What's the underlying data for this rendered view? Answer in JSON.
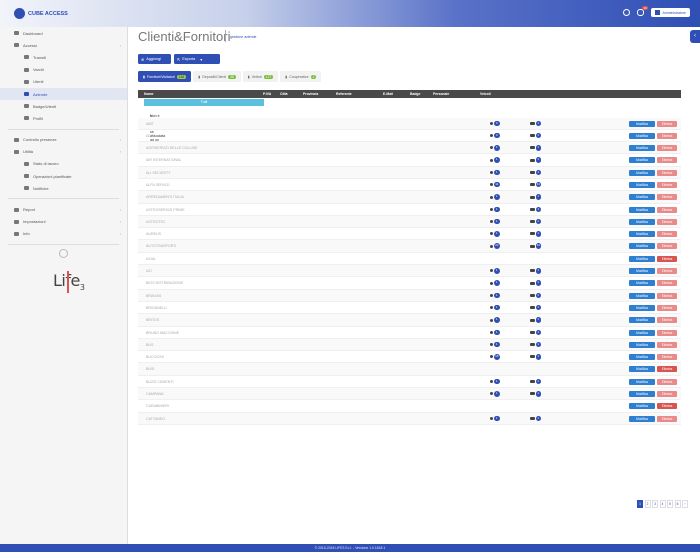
{
  "app": {
    "logo_text": "CUBE ACCESS"
  },
  "topbar": {
    "notif_count": "10",
    "user_label": "Amministratore"
  },
  "sidebar": {
    "items": [
      {
        "label": "Dashboard",
        "sub": false,
        "chev": false,
        "active": false
      },
      {
        "label": "Accessi",
        "sub": false,
        "chev": true,
        "active": false
      },
      {
        "label": "Transiti",
        "sub": true,
        "chev": false,
        "active": false
      },
      {
        "label": "Varchi",
        "sub": true,
        "chev": false,
        "active": false
      },
      {
        "label": "Utenti",
        "sub": true,
        "chev": false,
        "active": false
      },
      {
        "label": "Aziende",
        "sub": true,
        "chev": false,
        "active": true
      },
      {
        "label": "Badge/Utenti",
        "sub": true,
        "chev": false,
        "active": false
      },
      {
        "label": "Profili",
        "sub": true,
        "chev": false,
        "active": false
      },
      {
        "label": "Controllo presenze",
        "sub": false,
        "chev": true,
        "active": false
      },
      {
        "label": "Utilità",
        "sub": false,
        "chev": true,
        "active": false
      },
      {
        "label": "Stato di lavoro",
        "sub": true,
        "chev": false,
        "active": false
      },
      {
        "label": "Operazioni pianificate",
        "sub": true,
        "chev": false,
        "active": false
      },
      {
        "label": "Notifiche",
        "sub": true,
        "chev": false,
        "active": false
      },
      {
        "label": "Report",
        "sub": false,
        "chev": true,
        "active": false
      },
      {
        "label": "Impostazioni",
        "sub": false,
        "chev": true,
        "active": false
      },
      {
        "label": "Info",
        "sub": false,
        "chev": true,
        "active": false
      }
    ],
    "brand_text": "Life",
    "brand_sub": "3"
  },
  "header": {
    "title": "Clienti&Fornitori",
    "subtitle": "gestione aziende"
  },
  "toolbar": {
    "add_label": "Aggiungi",
    "export_label": "Esporta"
  },
  "tabs": [
    {
      "label": "Fornitori/Visitatori",
      "count": "146",
      "active": true
    },
    {
      "label": "Depositi/Clienti",
      "count": "38",
      "active": false
    },
    {
      "label": "Vettori",
      "count": "127",
      "active": false
    },
    {
      "label": "Cooperative",
      "count": "2",
      "active": false
    }
  ],
  "table": {
    "columns": [
      "Nome",
      "P.IVA",
      "Città",
      "Provincia",
      "Referente",
      "E-Mail",
      "Badge",
      "Personale",
      "Veicoli"
    ],
    "filter_label": "Tutti",
    "note": "Non è possibile eliminare un'azienda se associata ad un utente o mezzo",
    "edit_label": "Modifica",
    "delete_label": "Elimina",
    "rows": [
      {
        "name": "ABIT",
        "pers": "3",
        "veic": "1"
      },
      {
        "name": "ADIT",
        "pers": "3",
        "veic": "1"
      },
      {
        "name": "AGRISERVIZI DELLE COLLINE",
        "pers": "1",
        "veic": "1"
      },
      {
        "name": "AIR INTERNATIONAL",
        "pers": "1",
        "veic": "1"
      },
      {
        "name": "ALI SECURITY",
        "pers": "1",
        "veic": "1"
      },
      {
        "name": "ALFA SERVIZI",
        "pers": "11",
        "veic": "13"
      },
      {
        "name": "ARREDAMENTI ITALIA",
        "pers": "1",
        "veic": "1"
      },
      {
        "name": "ASTROSERVIZI PRIME",
        "pers": "1",
        "veic": "1"
      },
      {
        "name": "ASTROTEC",
        "pers": "1",
        "veic": "1"
      },
      {
        "name": "AUREUS",
        "pers": "1",
        "veic": "1"
      },
      {
        "name": "AUTOTRASPORTI",
        "pers": "24",
        "veic": "13"
      },
      {
        "name": "AXIAL",
        "pers": "",
        "veic": "",
        "strong": true
      },
      {
        "name": "AZI",
        "pers": "1",
        "veic": "1"
      },
      {
        "name": "BIOS DISTRIBUZIONE",
        "pers": "1",
        "veic": "1"
      },
      {
        "name": "BRAVIAS",
        "pers": "1",
        "veic": "1"
      },
      {
        "name": "BRIGANELLI",
        "pers": "1",
        "veic": "1"
      },
      {
        "name": "BRITOS",
        "pers": "1",
        "veic": "1"
      },
      {
        "name": "BRUNO MACCHINE",
        "pers": "1",
        "veic": "1"
      },
      {
        "name": "BUS",
        "pers": "1",
        "veic": "1"
      },
      {
        "name": "BUCCIONI",
        "pers": "18",
        "veic": "1"
      },
      {
        "name": "BUSI",
        "pers": "",
        "veic": "",
        "strong": true
      },
      {
        "name": "BUZZI CEMENTI",
        "pers": "1",
        "veic": "1"
      },
      {
        "name": "CAMPANA",
        "pers": "1",
        "veic": "1"
      },
      {
        "name": "CARABINIERI",
        "pers": "",
        "veic": "",
        "strong": true
      },
      {
        "name": "CATTANEO",
        "pers": "1",
        "veic": "1"
      }
    ]
  },
  "pagination": {
    "pages": [
      "1",
      "2",
      "3",
      "4",
      "5",
      "6",
      "›"
    ],
    "active": "1"
  },
  "footer": {
    "text": "© 2015-2018 LIFE3 S.r.l. - Versione 1.0.1618.1"
  }
}
